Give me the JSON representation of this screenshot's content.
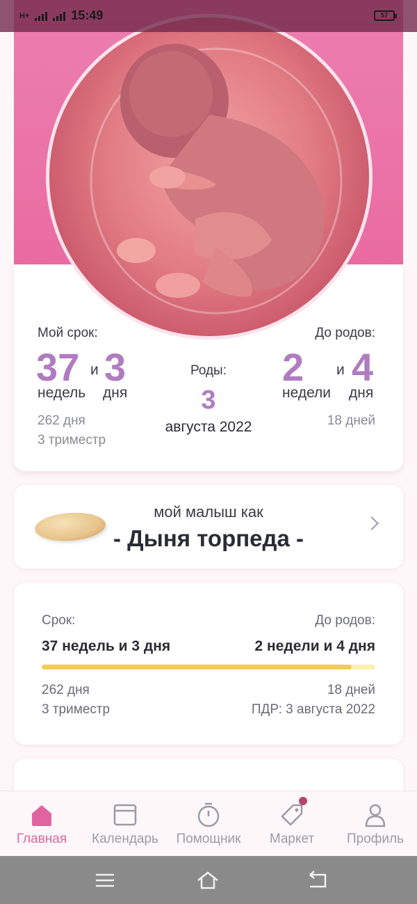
{
  "status_bar": {
    "network": "H+",
    "time": "15:49",
    "battery": "57"
  },
  "summary": {
    "my_term_label": "Мой срок:",
    "weeks_value": "37",
    "and_1": "и",
    "days_value": "3",
    "weeks_label": "недель",
    "days_label": "дня",
    "total_days": "262 дня",
    "trimester": "3 триместр",
    "birth_label": "Роды:",
    "birth_day": "3",
    "birth_month_year": "августа 2022",
    "until_birth_label": "До родов:",
    "left_weeks_value": "2",
    "and_2": "и",
    "left_days_value": "4",
    "left_weeks_label": "недели",
    "left_days_label": "дня",
    "left_total_days": "18 дней"
  },
  "baby_size": {
    "subtitle": "мой малыш как",
    "title": "- Дыня торпеда -",
    "icon": "chevron-right-icon"
  },
  "progress_card": {
    "term_label": "Срок:",
    "term_value": "37 недель и 3 дня",
    "until_label": "До родов:",
    "until_value": "2 недели и 4 дня",
    "progress_fraction": 0.93,
    "total_days": "262 дня",
    "trimester": "3 триместр",
    "left_days": "18 дней",
    "due_date": "ПДР: 3 августа 2022"
  },
  "tabs": [
    {
      "label": "Главная",
      "icon": "home-icon",
      "active": true
    },
    {
      "label": "Календарь",
      "icon": "calendar-icon",
      "active": false
    },
    {
      "label": "Помощник",
      "icon": "timer-icon",
      "active": false
    },
    {
      "label": "Маркет",
      "icon": "tag-icon",
      "active": false
    },
    {
      "label": "Профиль",
      "icon": "profile-icon",
      "active": false
    }
  ],
  "colors": {
    "accent": "#e0649f",
    "numbers": "#b07cc0",
    "progress": "#f2cd58",
    "hero": "#e9689f"
  }
}
